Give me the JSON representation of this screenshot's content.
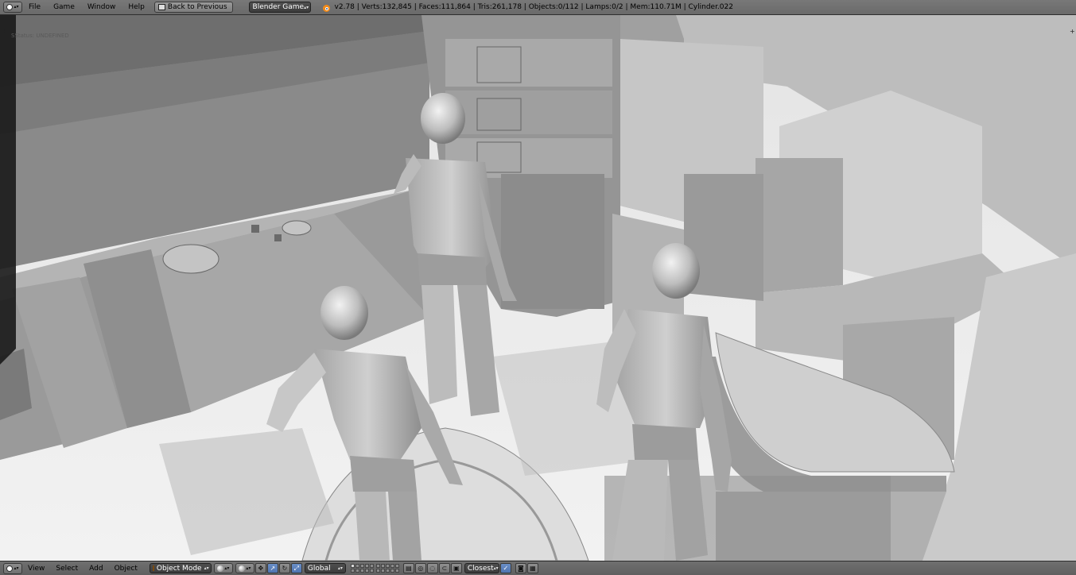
{
  "header": {
    "editor_icon": "info-editor-icon",
    "menus": [
      "File",
      "Game",
      "Window",
      "Help"
    ],
    "back_button": "Back to Previous",
    "engine": "Blender Game",
    "stats": "v2.78 | Verts:132,845 | Faces:111,864 | Tris:261,178 | Objects:0/112 | Lamps:0/2 | Mem:110.71M | Cylinder.022"
  },
  "viewport": {
    "status": "SStatus: UNDEFINED"
  },
  "footer": {
    "menus": [
      "View",
      "Select",
      "Add",
      "Object"
    ],
    "mode": "Object Mode",
    "orientation": "Global",
    "snap_target": "Closest"
  },
  "colors": {
    "header_bg": "#727272",
    "dropdown_bg": "#444444",
    "active_tool": "#5a7fbc",
    "scene_base": "#e9e9e9"
  }
}
